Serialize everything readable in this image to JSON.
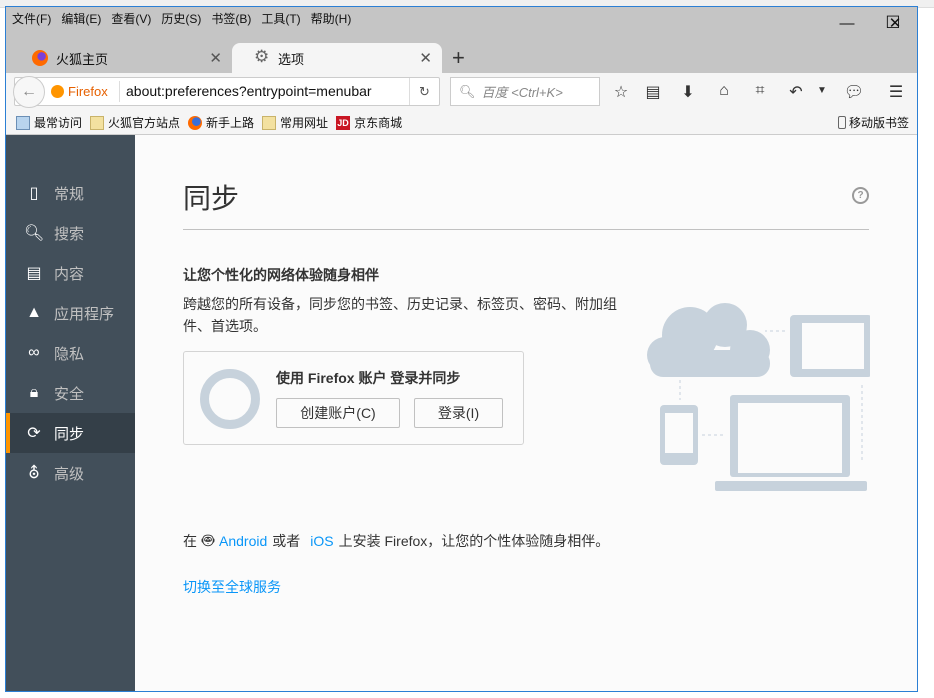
{
  "menu": [
    "文件(F)",
    "编辑(E)",
    "查看(V)",
    "历史(S)",
    "书签(B)",
    "工具(T)",
    "帮助(H)"
  ],
  "window_controls": {
    "minimize": "—",
    "maximize": "☐",
    "close": "✕"
  },
  "tabs": [
    {
      "label": "火狐主页"
    },
    {
      "label": "选项"
    }
  ],
  "new_tab": "+",
  "url": {
    "identity": "Firefox",
    "value": "about:preferences?entrypoint=menubar"
  },
  "search": {
    "placeholder": "百度 <Ctrl+K>"
  },
  "bookmarks": [
    "最常访问",
    "火狐官方站点",
    "新手上路",
    "常用网址",
    "京东商城"
  ],
  "jd_logo": "JD",
  "mobile_bookmarks": "移动版书签",
  "sidebar": [
    {
      "label": "常规"
    },
    {
      "label": "搜索"
    },
    {
      "label": "内容"
    },
    {
      "label": "应用程序"
    },
    {
      "label": "隐私"
    },
    {
      "label": "安全"
    },
    {
      "label": "同步"
    },
    {
      "label": "高级"
    }
  ],
  "page": {
    "title": "同步",
    "help": "?",
    "subtitle": "让您个性化的网络体验随身相伴",
    "description": "跨越您的所有设备，同步您的书签、历史记录、标签页、密码、附加组件、首选项。",
    "box_title": "使用 Firefox 账户 登录并同步",
    "create_button": "创建账户(C)",
    "signin_button": "登录(I)",
    "mobile_prefix": "在",
    "android": "Android",
    "or": "或者",
    "ios": "iOS",
    "mobile_suffix": "上安装 Firefox，让您的个性体验随身相伴。",
    "switch_link": "切换至全球服务"
  },
  "colors": {
    "accent": "#ff9500",
    "link": "#0996f8",
    "sidebar": "#424f5a"
  }
}
